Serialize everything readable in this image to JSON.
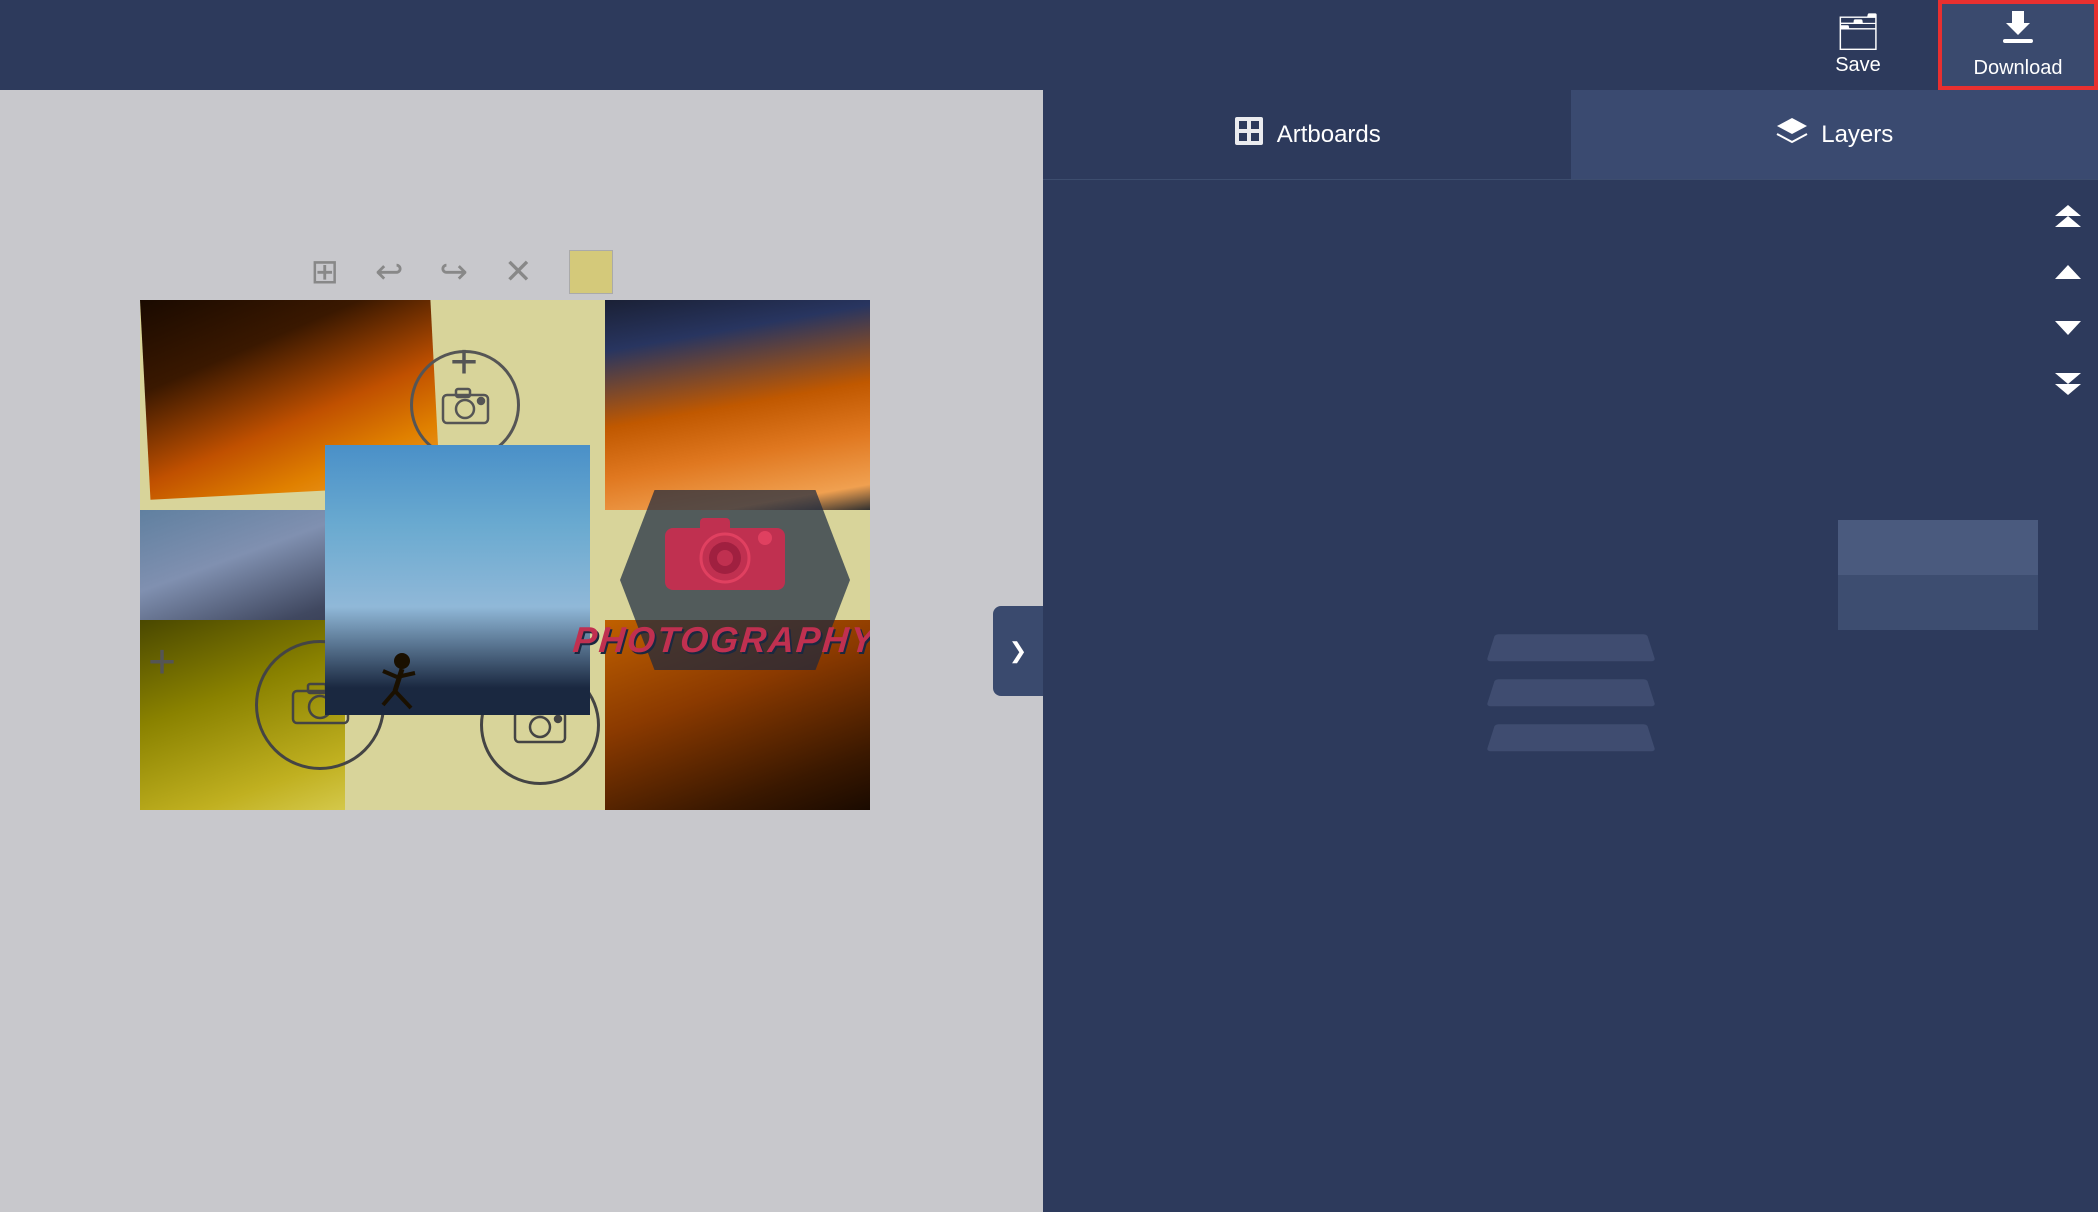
{
  "header": {
    "save_label": "Save",
    "download_label": "Download",
    "save_icon": "🗂",
    "download_icon": "⬇"
  },
  "sidebar": {
    "artboards_tab": "Artboards",
    "layers_tab": "Layers",
    "artboards_icon": "▣",
    "layers_icon": "◈",
    "toggle_icon": "❯"
  },
  "toolbar": {
    "grid_icon": "⊞",
    "undo_icon": "↩",
    "redo_icon": "↪",
    "close_icon": "✕"
  },
  "arrows": {
    "up_double": "⏫",
    "up": "🔼",
    "down": "🔽",
    "down_double": "⏬"
  }
}
